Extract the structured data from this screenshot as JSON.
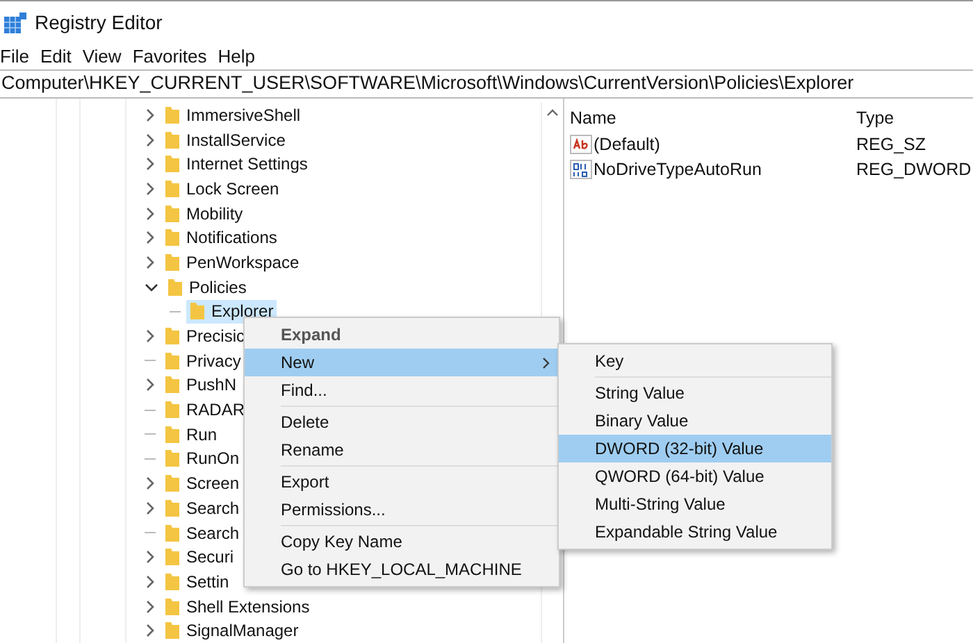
{
  "window": {
    "title": "Registry Editor"
  },
  "menu_bar": [
    "File",
    "Edit",
    "View",
    "Favorites",
    "Help"
  ],
  "address": "Computer\\HKEY_CURRENT_USER\\SOFTWARE\\Microsoft\\Windows\\CurrentVersion\\Policies\\Explorer",
  "tree": [
    {
      "label": "ImmersiveShell",
      "kind": "closed",
      "selected": false
    },
    {
      "label": "InstallService",
      "kind": "closed",
      "selected": false
    },
    {
      "label": "Internet Settings",
      "kind": "closed",
      "selected": false
    },
    {
      "label": "Lock Screen",
      "kind": "closed",
      "selected": false
    },
    {
      "label": "Mobility",
      "kind": "closed",
      "selected": false
    },
    {
      "label": "Notifications",
      "kind": "closed",
      "selected": false
    },
    {
      "label": "PenWorkspace",
      "kind": "closed",
      "selected": false
    },
    {
      "label": "Policies",
      "kind": "open",
      "selected": false,
      "children": [
        {
          "label": "Explorer",
          "kind": "none",
          "selected": true
        }
      ]
    },
    {
      "label": "Precisic",
      "kind": "closed",
      "selected": false
    },
    {
      "label": "Privacy",
      "kind": "none",
      "selected": false
    },
    {
      "label": "PushN",
      "kind": "closed",
      "selected": false
    },
    {
      "label": "RADAR",
      "kind": "none",
      "selected": false
    },
    {
      "label": "Run",
      "kind": "none",
      "selected": false
    },
    {
      "label": "RunOn",
      "kind": "none",
      "selected": false
    },
    {
      "label": "Screen",
      "kind": "closed",
      "selected": false
    },
    {
      "label": "Search",
      "kind": "closed",
      "selected": false
    },
    {
      "label": "Search",
      "kind": "none",
      "selected": false
    },
    {
      "label": "Securi",
      "kind": "closed",
      "selected": false
    },
    {
      "label": "Settin",
      "kind": "closed",
      "selected": false
    },
    {
      "label": "Shell Extensions",
      "kind": "closed",
      "selected": false
    },
    {
      "label": "SignalManager",
      "kind": "closed",
      "selected": false
    }
  ],
  "values": {
    "columns": [
      "Name",
      "Type"
    ],
    "rows": [
      {
        "name": "(Default)",
        "type": "REG_SZ",
        "kind": "string"
      },
      {
        "name": "NoDriveTypeAutoRun",
        "type": "REG_DWORD",
        "kind": "binary"
      }
    ]
  },
  "context_menu": [
    {
      "label": "Expand",
      "kind": "bold",
      "selected": false
    },
    {
      "label": "New",
      "kind": "submenu",
      "selected": true
    },
    {
      "label": "Find...",
      "kind": "item",
      "selected": false
    },
    {
      "kind": "separator"
    },
    {
      "label": "Delete",
      "kind": "item",
      "selected": false
    },
    {
      "label": "Rename",
      "kind": "item",
      "selected": false
    },
    {
      "kind": "separator"
    },
    {
      "label": "Export",
      "kind": "item",
      "selected": false
    },
    {
      "label": "Permissions...",
      "kind": "item",
      "selected": false
    },
    {
      "kind": "separator"
    },
    {
      "label": "Copy Key Name",
      "kind": "item",
      "selected": false
    },
    {
      "label": "Go to HKEY_LOCAL_MACHINE",
      "kind": "item",
      "selected": false
    }
  ],
  "submenu": [
    {
      "label": "Key",
      "kind": "item",
      "selected": false
    },
    {
      "kind": "separator"
    },
    {
      "label": "String Value",
      "kind": "item",
      "selected": false
    },
    {
      "label": "Binary Value",
      "kind": "item",
      "selected": false
    },
    {
      "label": "DWORD (32-bit) Value",
      "kind": "item",
      "selected": true
    },
    {
      "label": "QWORD (64-bit) Value",
      "kind": "item",
      "selected": false
    },
    {
      "label": "Multi-String Value",
      "kind": "item",
      "selected": false
    },
    {
      "label": "Expandable String Value",
      "kind": "item",
      "selected": false
    }
  ]
}
